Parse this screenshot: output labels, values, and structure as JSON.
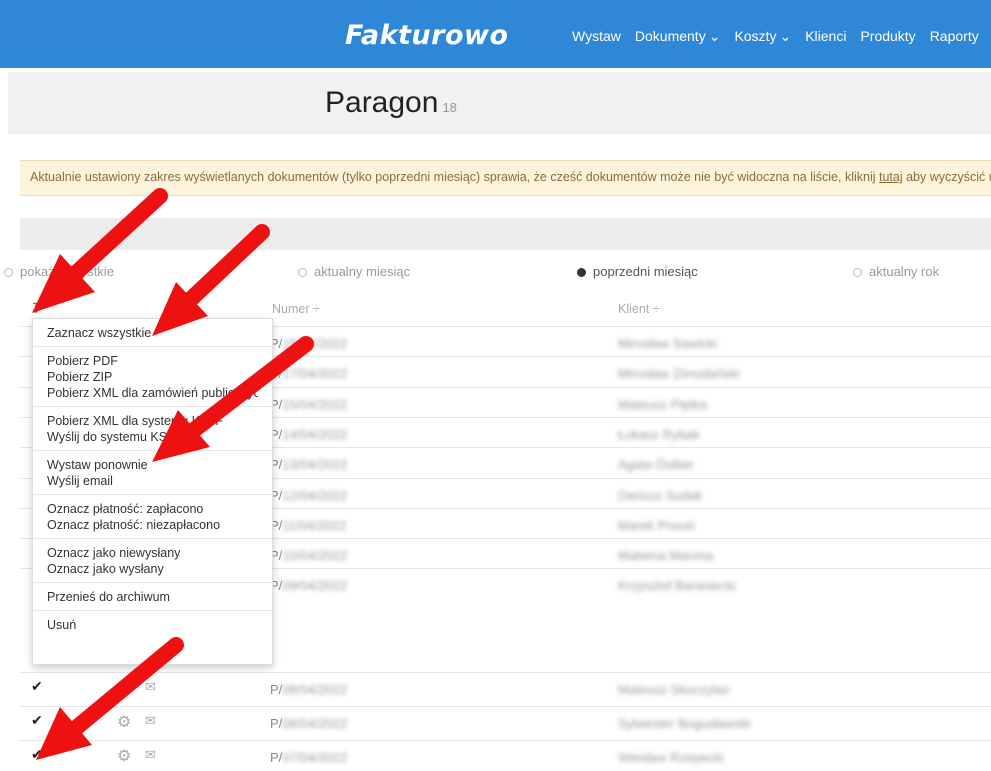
{
  "app": {
    "logo": "Fakturowo"
  },
  "nav": {
    "items": [
      {
        "label": "Wystaw",
        "dropdown": false
      },
      {
        "label": "Dokumenty",
        "dropdown": true
      },
      {
        "label": "Koszty",
        "dropdown": true
      },
      {
        "label": "Klienci",
        "dropdown": false
      },
      {
        "label": "Produkty",
        "dropdown": false
      },
      {
        "label": "Raporty",
        "dropdown": false
      }
    ]
  },
  "page": {
    "title": "Paragon",
    "count": "18"
  },
  "alert": {
    "text_before": "Aktualnie ustawiony zakres wyświetlanych dokumentów (tylko poprzedni miesiąc) sprawia, że cześć dokumentów może nie być widoczna na liście, kliknij ",
    "link": "tutaj",
    "text_after": " aby wyczyścić ust"
  },
  "filters": [
    {
      "label": "pokaż wszystkie",
      "selected": false
    },
    {
      "label": "aktualny miesiąc",
      "selected": false
    },
    {
      "label": "poprzedni miesiąc",
      "selected": true
    },
    {
      "label": "aktualny rok",
      "selected": false
    }
  ],
  "table": {
    "headers": {
      "numer": "Numer ÷",
      "klient": "Klient ÷"
    },
    "rows": [
      {
        "prefix": "P/",
        "rest": "18/04/2022",
        "client": "Mirosław Sawicki"
      },
      {
        "prefix": "P/",
        "rest": "17/04/2022",
        "client": "Mirosław Zimudański"
      },
      {
        "prefix": "P/",
        "rest": "15/04/2022",
        "client": "Mateusz Piętka"
      },
      {
        "prefix": "P/",
        "rest": "14/04/2022",
        "client": "Łukasz Rybak"
      },
      {
        "prefix": "P/",
        "rest": "13/04/2022",
        "client": "Agata Ósiber"
      },
      {
        "prefix": "P/",
        "rest": "12/04/2022",
        "client": "Dariusz Sudak"
      },
      {
        "prefix": "P/",
        "rest": "11/04/2022",
        "client": "Marek Procel"
      },
      {
        "prefix": "P/",
        "rest": "10/04/2022",
        "client": "Malwina Marona"
      },
      {
        "prefix": "P/",
        "rest": "09/04/2022",
        "client": "Krzysztof Baraniecki"
      },
      {
        "prefix": "P/",
        "rest": "08/04/2022",
        "client": "Mateusz Skoczylas"
      },
      {
        "prefix": "P/",
        "rest": "08/04/2022",
        "client": "Sylwester Bogusławski"
      },
      {
        "prefix": "P/",
        "rest": "07/04/2022",
        "client": "Wiesław Rzepecki"
      }
    ]
  },
  "menu": {
    "groups": [
      [
        "Zaznacz wszystkie"
      ],
      [
        "Pobierz PDF",
        "Pobierz ZIP",
        "Pobierz XML dla zamówień publicznych"
      ],
      [
        "Pobierz XML dla systemu KSeF",
        "Wyślij do systemu KSeF"
      ],
      [
        "Wystaw ponownie",
        "Wyślij email"
      ],
      [
        "Oznacz płatność: zapłacono",
        "Oznacz płatność: niezapłacono"
      ],
      [
        "Oznacz jako niewysłany",
        "Oznacz jako wysłany"
      ],
      [
        "Przenieś do archiwum"
      ],
      [
        "Usuń"
      ]
    ]
  },
  "colors": {
    "topbar": "#2f87d8",
    "alert_bg": "#fbf3dc",
    "arrow": "#ee1111"
  },
  "icons": {
    "sort": "sort-icon",
    "check": "check-icon",
    "gear": "gear-icon",
    "mail": "mail-icon"
  }
}
